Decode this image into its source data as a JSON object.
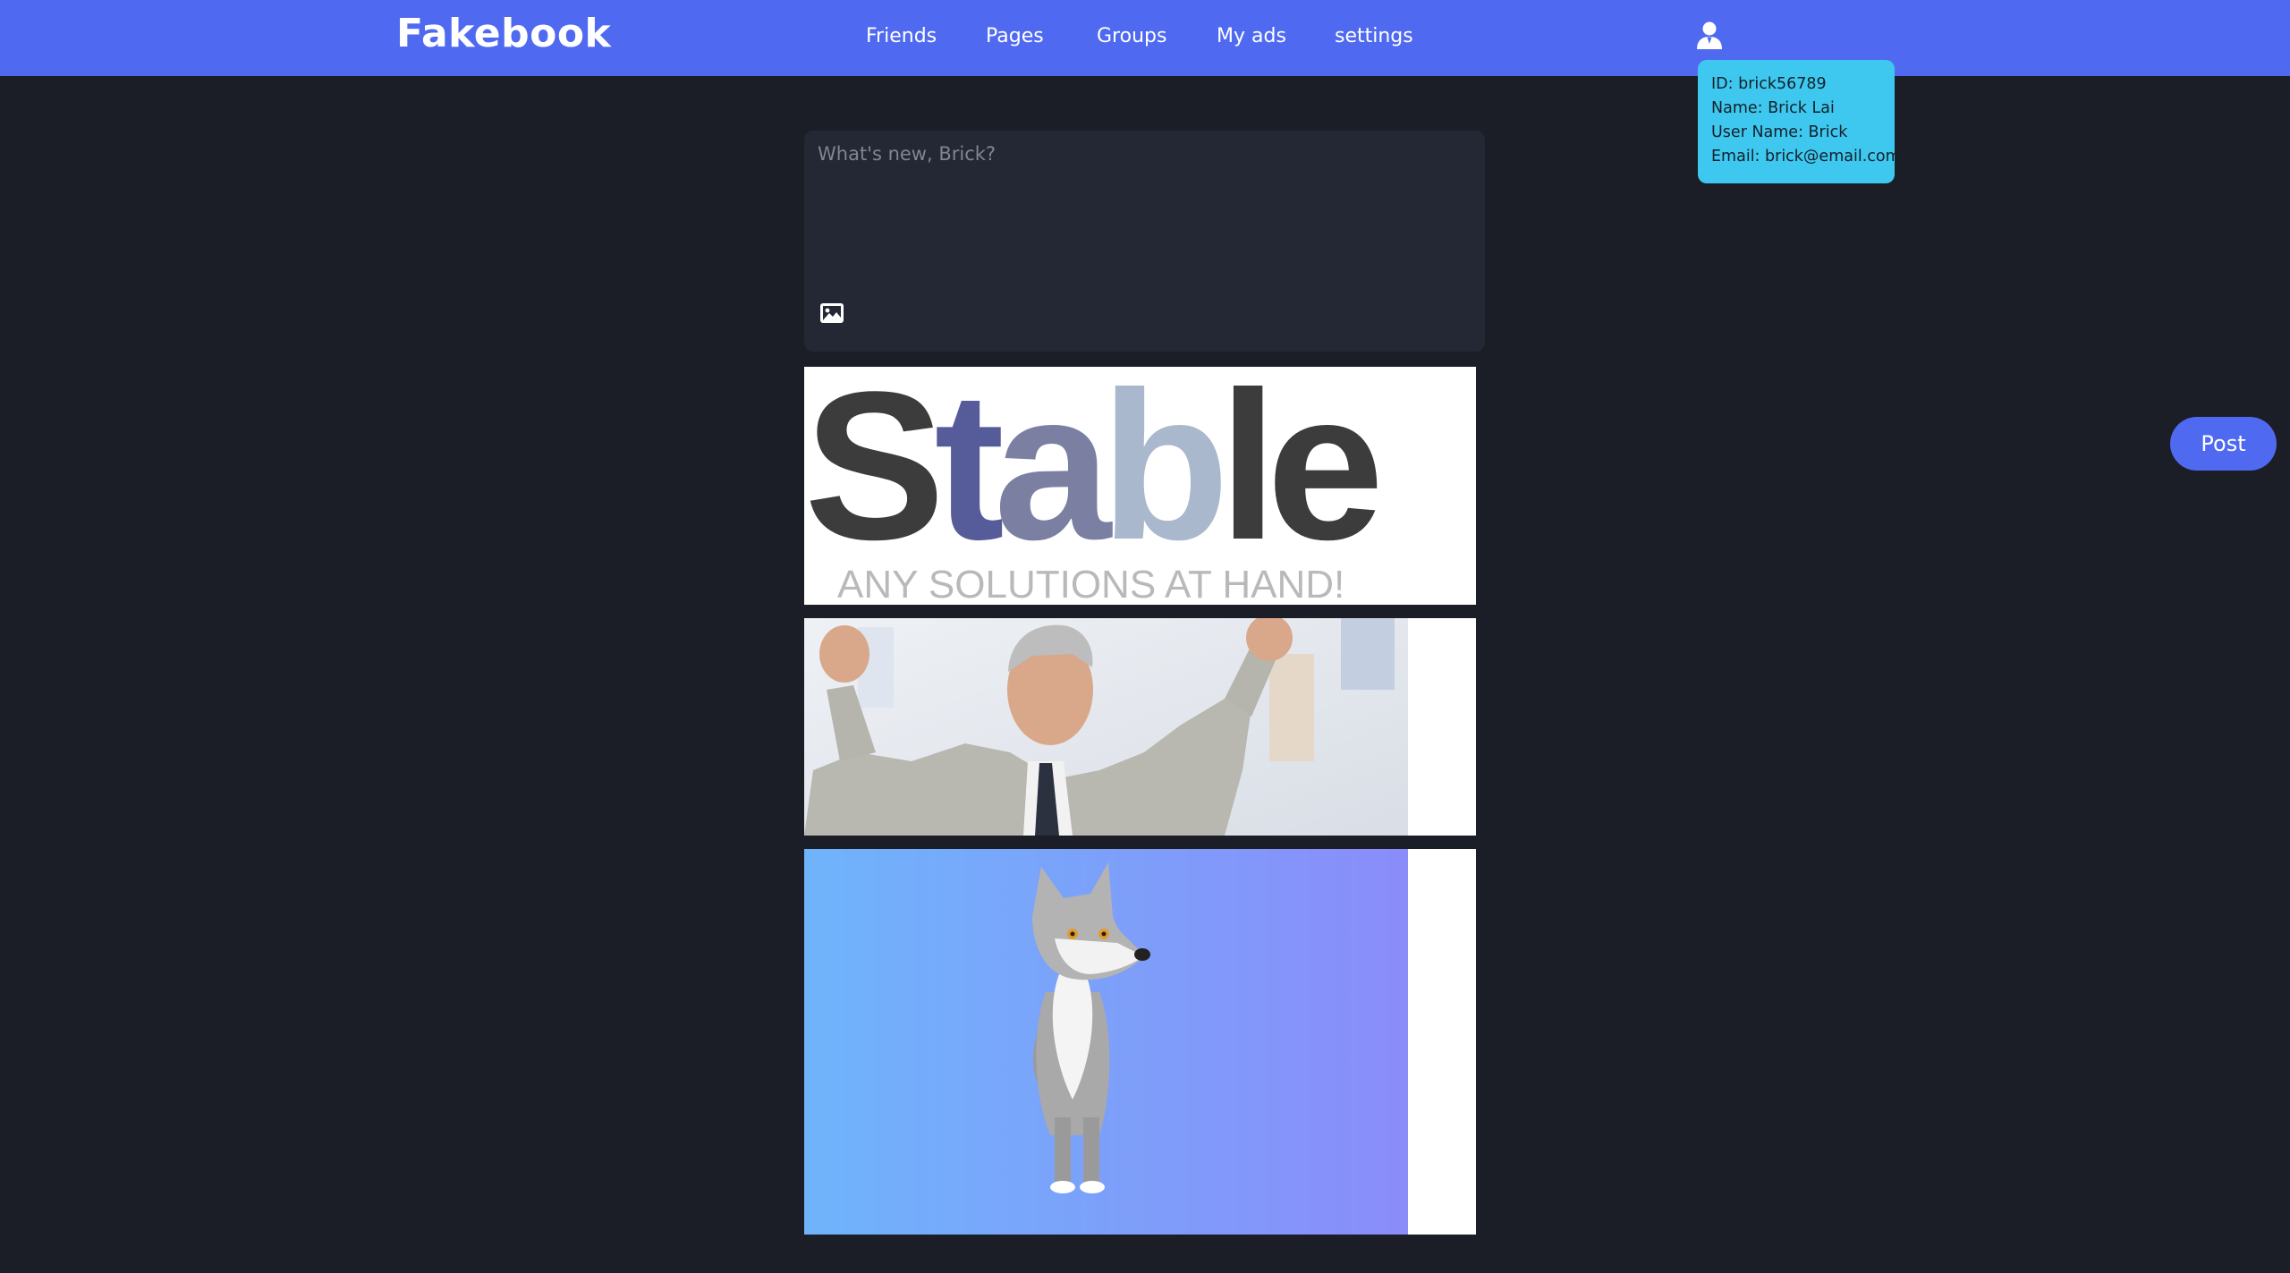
{
  "header": {
    "brand": "Fakebook",
    "nav": {
      "friends": "Friends",
      "pages": "Pages",
      "groups": "Groups",
      "my_ads": "My ads",
      "settings": "settings"
    },
    "user_icon": "user-icon",
    "color": "#4f6af0"
  },
  "user_popup": {
    "id_line": "ID: brick56789",
    "name_line": "Name: Brick Lai",
    "username_line": "User Name: Brick",
    "email_line": "Email: brick@email.com",
    "color": "#3fc8ef"
  },
  "composer": {
    "placeholder": "What's new, Brick?",
    "value": "",
    "image_icon": "image-icon",
    "post_label": "Post"
  },
  "ads": [
    {
      "headline": "Stable",
      "tagline": "ANY SOLUTIONS AT HAND!"
    },
    {
      "image": "businessman-celebrating"
    },
    {
      "image": "wolf-cartoon"
    }
  ],
  "colors": {
    "background": "#1b1e27",
    "card": "#242834",
    "accent": "#4f6af0"
  }
}
